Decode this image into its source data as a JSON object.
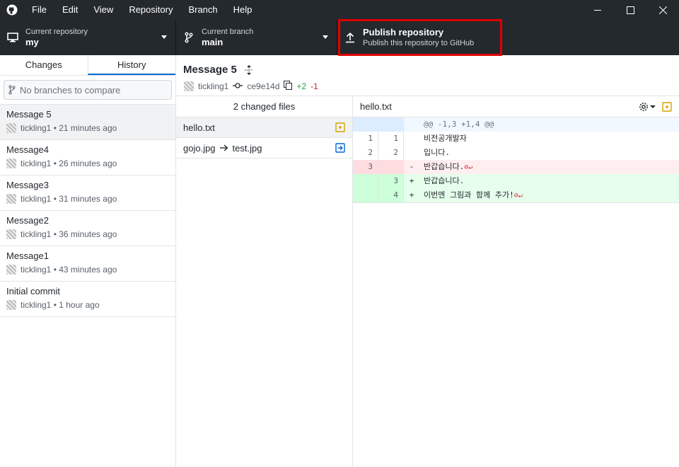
{
  "titlebar": {
    "menu": [
      "File",
      "Edit",
      "View",
      "Repository",
      "Branch",
      "Help"
    ]
  },
  "toolbar": {
    "repo_label": "Current repository",
    "repo_value": "my",
    "branch_label": "Current branch",
    "branch_value": "main",
    "publish_title": "Publish repository",
    "publish_subtitle": "Publish this repository to GitHub"
  },
  "sidebar": {
    "tabs": [
      "Changes",
      "History"
    ],
    "active_tab": "History",
    "compare_placeholder": "No branches to compare",
    "commits": [
      {
        "title": "Message 5",
        "author": "tickling1",
        "time": "21 minutes ago"
      },
      {
        "title": "Message4",
        "author": "tickling1",
        "time": "26 minutes ago"
      },
      {
        "title": "Message3",
        "author": "tickling1",
        "time": "31 minutes ago"
      },
      {
        "title": "Message2",
        "author": "tickling1",
        "time": "36 minutes ago"
      },
      {
        "title": "Message1",
        "author": "tickling1",
        "time": "43 minutes ago"
      },
      {
        "title": "Initial commit",
        "author": "tickling1",
        "time": "1 hour ago"
      }
    ]
  },
  "commit": {
    "title": "Message 5",
    "author": "tickling1",
    "sha": "ce9e14d",
    "additions": "+2",
    "deletions": "-1"
  },
  "files": {
    "header": "2 changed files",
    "items": [
      {
        "name": "hello.txt",
        "status": "modified"
      },
      {
        "name": "gojo.jpg",
        "renamed_to": "test.jpg",
        "status": "renamed"
      }
    ]
  },
  "diff": {
    "filename": "hello.txt",
    "hunk": "@@ -1,3 +1,4 @@",
    "lines": [
      {
        "type": "context",
        "old": "1",
        "new": "1",
        "sign": "",
        "text": "비전공개발자"
      },
      {
        "type": "context",
        "old": "2",
        "new": "2",
        "sign": "",
        "text": "입니다."
      },
      {
        "type": "removed",
        "old": "3",
        "new": "",
        "sign": "-",
        "text": "반갑습니다."
      },
      {
        "type": "added",
        "old": "",
        "new": "3",
        "sign": "+",
        "text": "반갑습니다."
      },
      {
        "type": "added",
        "old": "",
        "new": "4",
        "sign": "+",
        "text": "이번엔 그림과 함께 추가!"
      }
    ]
  },
  "colors": {
    "titlebar_bg": "#24292e",
    "highlight": "#e00000",
    "modified": "#d4a200",
    "renamed": "#0366d6"
  }
}
